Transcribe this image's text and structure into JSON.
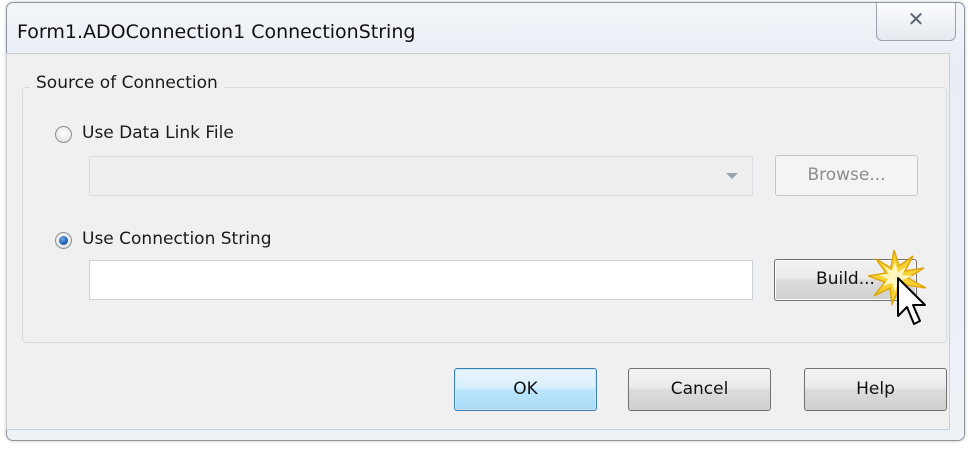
{
  "window": {
    "title": "Form1.ADOConnection1 ConnectionString",
    "close_glyph": "✕"
  },
  "source_group": {
    "legend": "Source of Connection",
    "use_data_link_file": {
      "label": "Use Data Link File",
      "checked": false,
      "combo_value": ""
    },
    "browse_button": "Browse...",
    "use_connection_string": {
      "label": "Use Connection String",
      "checked": true,
      "value": ""
    },
    "build_button": "Build..."
  },
  "footer": {
    "ok_label": "OK",
    "cancel_label": "Cancel",
    "help_label": "Help"
  },
  "icons": {
    "close": "close-icon",
    "dropdown": "chevron-down-icon",
    "cursor": "mouse-pointer-icon",
    "click_burst": "click-highlight-icon"
  },
  "colors": {
    "default_button": "#bee6fd",
    "radio_selected": "#1d5fb5",
    "click_burst": "#f5c21b"
  }
}
